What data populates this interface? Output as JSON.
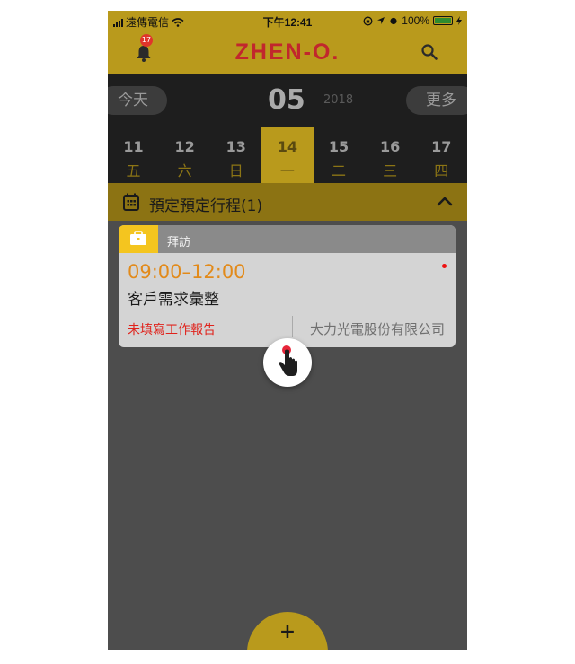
{
  "status_bar": {
    "carrier": "遠傳電信",
    "time": "下午12:41",
    "battery": "100%"
  },
  "header": {
    "notification_count": "17",
    "logo": "ZHEN-O."
  },
  "date_nav": {
    "today_label": "今天",
    "month": "05",
    "year": "2018",
    "more_label": "更多"
  },
  "week": [
    {
      "date": "11",
      "weekday": "五"
    },
    {
      "date": "12",
      "weekday": "六"
    },
    {
      "date": "13",
      "weekday": "日"
    },
    {
      "date": "14",
      "weekday": "一",
      "selected": true
    },
    {
      "date": "15",
      "weekday": "二"
    },
    {
      "date": "16",
      "weekday": "三"
    },
    {
      "date": "17",
      "weekday": "四"
    }
  ],
  "section": {
    "title": "預定預定行程(1)"
  },
  "events": [
    {
      "type": "拜訪",
      "time": "09:00–12:00",
      "description": "客戶需求彙整",
      "report_status": "未填寫工作報告",
      "company": "大力光電股份有限公司"
    }
  ],
  "fab": {
    "label": "+"
  },
  "colors": {
    "accent": "#b99a1c",
    "time_orange": "#e28a1a",
    "warning_red": "#e0221b",
    "logo_red": "#c1272d"
  }
}
